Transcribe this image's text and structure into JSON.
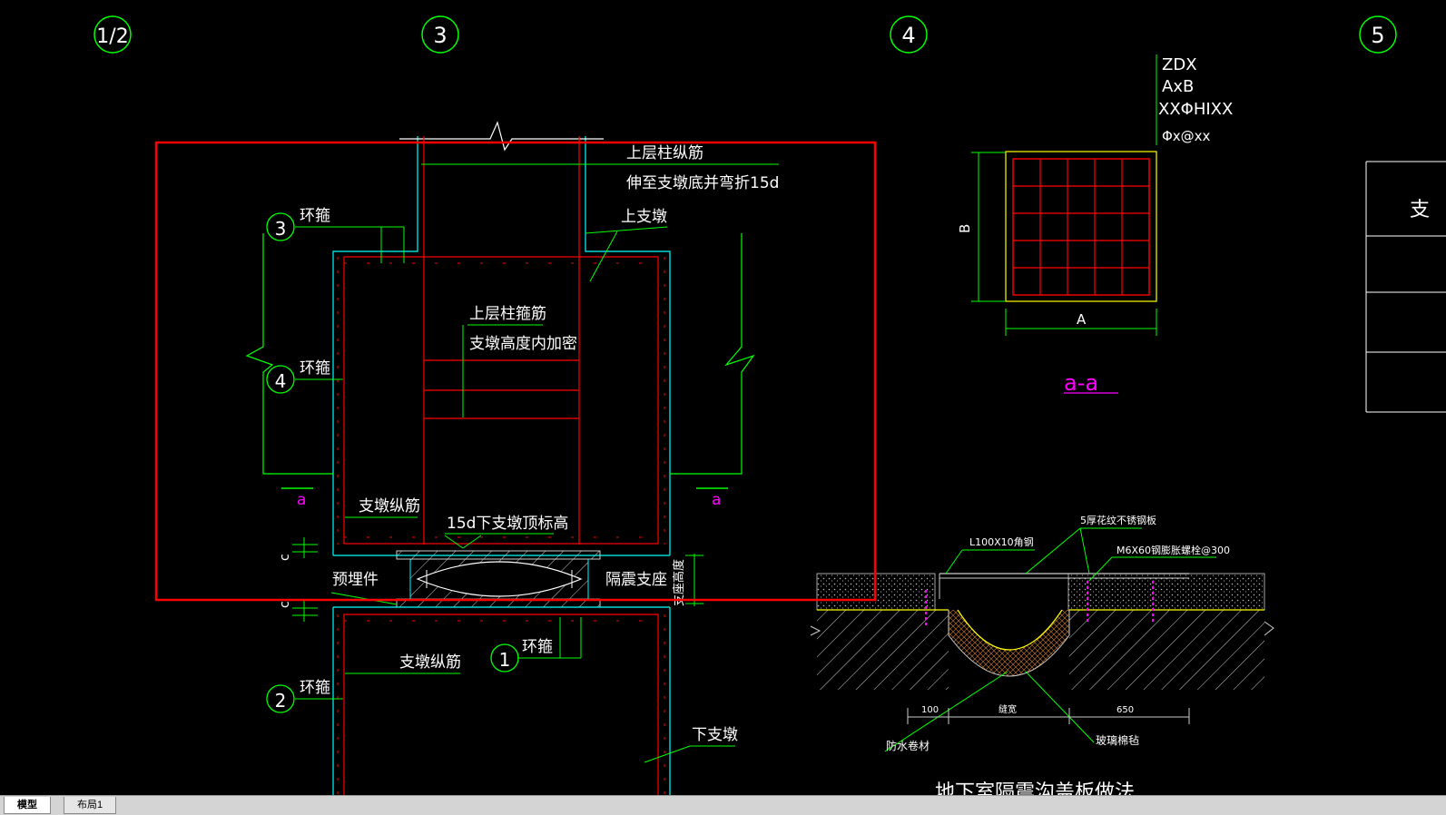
{
  "colors": {
    "background": "#000000",
    "green": "#00ff00",
    "red": "#ff0000",
    "cyan": "#00ffff",
    "white": "#ffffff",
    "magenta": "#ff00ff",
    "yellow": "#ffff00",
    "selection": "#ff0000"
  },
  "grid_axes": [
    "1/2",
    "3",
    "4",
    "5"
  ],
  "detail_markers": [
    "3",
    "4",
    "1",
    "2"
  ],
  "labels": {
    "upper_bar": "上层柱纵筋",
    "upper_bar_note": "伸至支墩底并弯折15d",
    "upper_pier": "上支墩",
    "stirrup": "环箍",
    "upper_tie": "上层柱箍筋",
    "upper_tie_note": "支墩高度内加密",
    "pier_bar": "支墩纵筋",
    "overlap_text": "15d下支墩顶标高",
    "embedded": "预埋件",
    "bearing": "隔震支座",
    "bearing_height": "支座高度",
    "lower_pier": "下支墩",
    "dim_c": "c",
    "section_mark": "a",
    "section_title": "a-a",
    "sec_dim_b": "B",
    "sec_dim_a": "A",
    "zdx": "ZDX",
    "axb": "AxB",
    "xx": "XXΦHIXX",
    "phi": "Φx@xx",
    "angle": "L100X10角钢",
    "plate": "5厚花纹不锈钢板",
    "bolt": "M6X60钢膨胀螺栓@300",
    "dim_100": "100",
    "dim_width": "缝宽",
    "dim_650": "650",
    "waterproof": "防水卷材",
    "glasswool": "玻璃棉毡",
    "joint_title": "地下室隔震沟盖板做法",
    "table_col": "支"
  },
  "tabs": [
    {
      "label": "模型",
      "active": true
    },
    {
      "label": "布局1",
      "active": false
    }
  ]
}
